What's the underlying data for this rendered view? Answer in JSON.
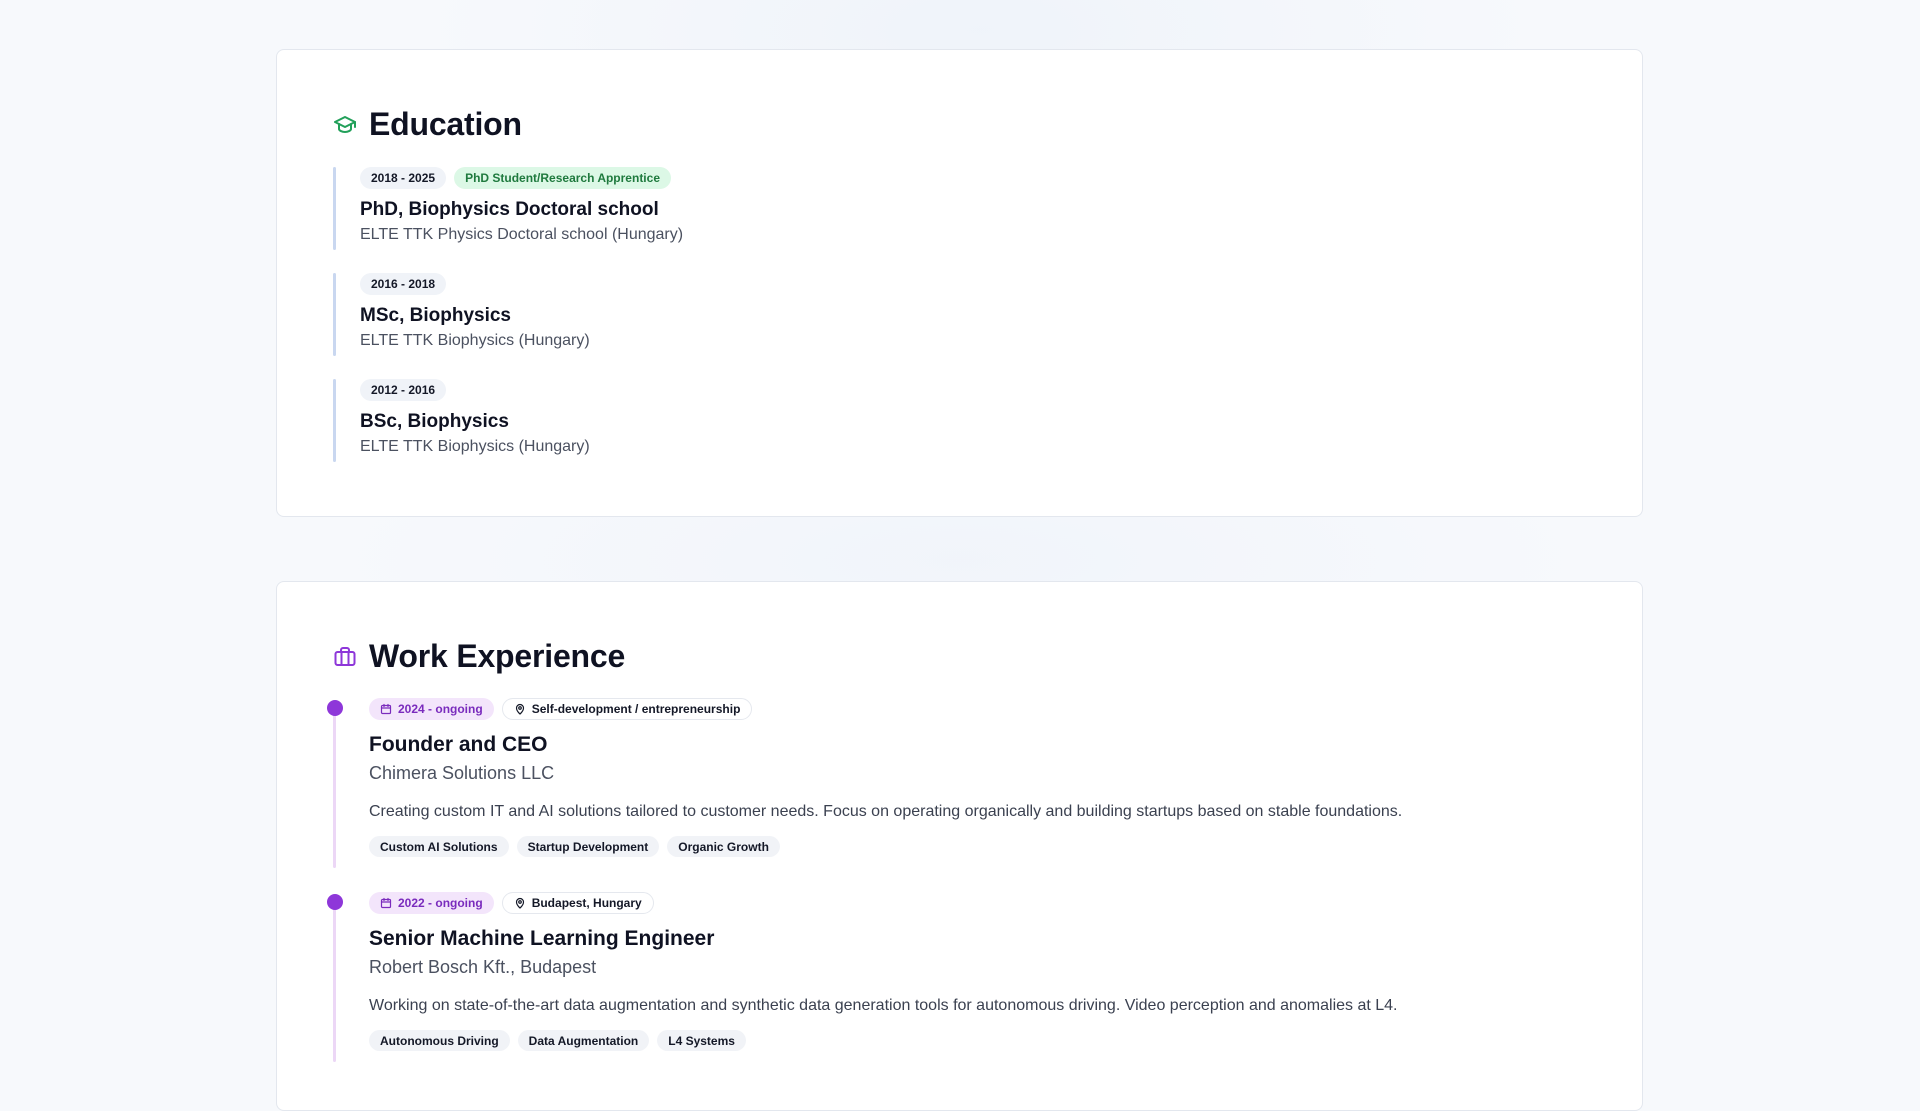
{
  "education": {
    "title": "Education",
    "icon": "graduation-cap-icon",
    "accent": "#22a05a",
    "items": [
      {
        "years": "2018 - 2025",
        "role": "PhD Student/Research Apprentice",
        "degree": "PhD, Biophysics Doctoral school",
        "school": "ELTE TTK Physics Doctoral school (Hungary)"
      },
      {
        "years": "2016 - 2018",
        "role": "",
        "degree": "MSc, Biophysics",
        "school": "ELTE TTK Biophysics (Hungary)"
      },
      {
        "years": "2012 - 2016",
        "role": "",
        "degree": "BSc, Biophysics",
        "school": "ELTE TTK Biophysics (Hungary)"
      }
    ]
  },
  "work": {
    "title": "Work Experience",
    "icon": "briefcase-icon",
    "accent": "#8e37d9",
    "items": [
      {
        "years": "2024 - ongoing",
        "location": "Self-development / entrepreneurship",
        "title": "Founder and CEO",
        "company": "Chimera Solutions LLC",
        "description": "Creating custom IT and AI solutions tailored to customer needs. Focus on operating organically and building startups based on stable foundations.",
        "tags": [
          "Custom AI Solutions",
          "Startup Development",
          "Organic Growth"
        ]
      },
      {
        "years": "2022 - ongoing",
        "location": "Budapest, Hungary",
        "title": "Senior Machine Learning Engineer",
        "company": "Robert Bosch Kft., Budapest",
        "description": "Working on state-of-the-art data augmentation and synthetic data generation tools for autonomous driving. Video perception and anomalies at L4.",
        "tags": [
          "Autonomous Driving",
          "Data Augmentation",
          "L4 Systems"
        ]
      }
    ]
  }
}
